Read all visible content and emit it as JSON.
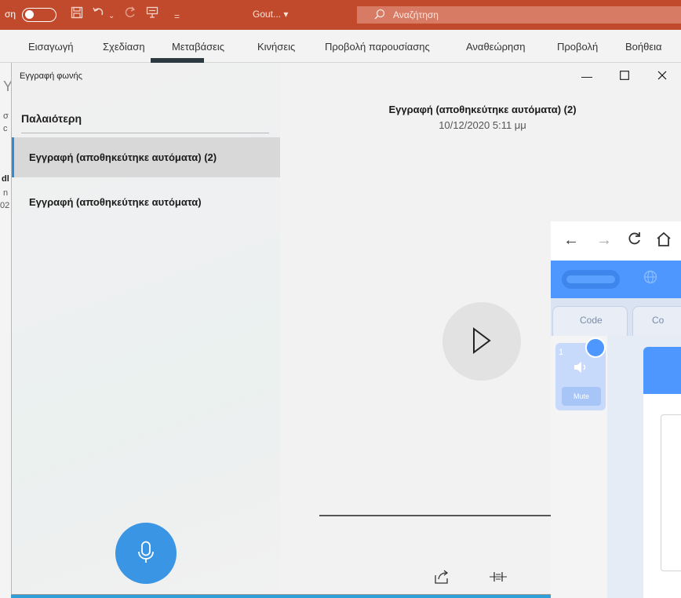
{
  "ppt": {
    "autosave_label": "ση",
    "doc_title": "Gout... ▾",
    "search_placeholder": "Αναζήτηση",
    "tabs": [
      "Εισαγωγή",
      "Σχεδίαση",
      "Μεταβάσεις",
      "Κινήσεις",
      "Προβολή παρουσίασης",
      "Αναθεώρηση",
      "Προβολή",
      "Βοήθεια"
    ],
    "left_strip_text": [
      "Y",
      "σ",
      "c",
      "dl",
      "n",
      "02"
    ],
    "accent": "#c24a2c"
  },
  "voice_recorder": {
    "app_name": "Εγγραφή φωνής",
    "window_controls": {
      "minimize": "—",
      "maximize": "☐",
      "close": "✕"
    },
    "sidebar_header": "Παλαιότερη",
    "recordings": [
      {
        "label": "Εγγραφή (αποθηκεύτηκε αυτόματα) (2)",
        "selected": true
      },
      {
        "label": "Εγγραφή (αποθηκεύτηκε αυτόματα)",
        "selected": false
      }
    ],
    "detail": {
      "title": "Εγγραφή (αποθηκεύτηκε αυτόματα) (2)",
      "date": "10/12/2020 5:11 μμ"
    },
    "icons": {
      "record": "microphone-icon",
      "play": "play-icon",
      "share": "share-icon",
      "trim": "trim-icon"
    },
    "accent": "#3a95e4"
  },
  "browser": {
    "nav": {
      "back": "←",
      "forward": "→",
      "reload": "C",
      "home": "⌂"
    },
    "scratch": {
      "tabs": [
        "Code",
        "Co"
      ],
      "sound_category_number": "1",
      "mute_label": "Mute",
      "brand_color": "#4d97ff"
    }
  }
}
